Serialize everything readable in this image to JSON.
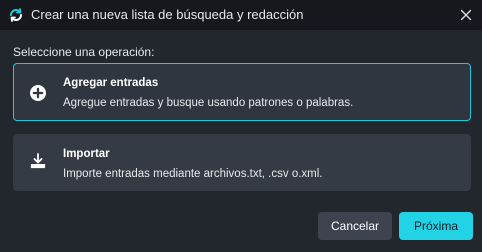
{
  "dialog": {
    "title": "Crear una nueva lista de búsqueda y redacción",
    "app_icon": "sync-logo-icon",
    "close_icon": "close-icon"
  },
  "prompt": "Seleccione una operación:",
  "options": [
    {
      "icon": "plus-circle-icon",
      "title": "Agregar entradas",
      "description": "Agregue entradas y busque usando patrones o palabras.",
      "selected": true
    },
    {
      "icon": "import-download-icon",
      "title": "Importar",
      "description": "Importe entradas mediante archivos.txt, .csv o.xml.",
      "selected": false
    }
  ],
  "buttons": {
    "cancel": "Cancelar",
    "next": "Próxima"
  },
  "colors": {
    "accent": "#22d3e6",
    "selected_border": "#22c7d8",
    "titlebar": "#15181c",
    "background": "#22262d"
  }
}
